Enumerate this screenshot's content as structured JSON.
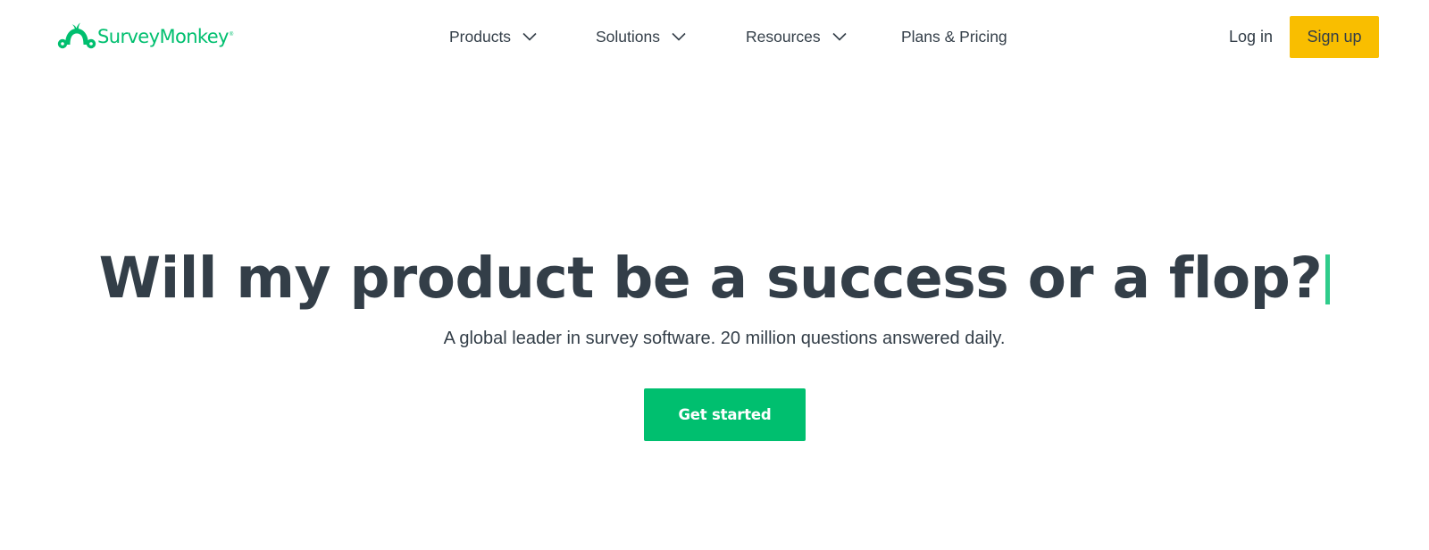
{
  "header": {
    "logo": {
      "text": "SurveyMonkey",
      "registered": "®",
      "icon": "surveymonkey-logo-icon",
      "color": "#00bf6f"
    },
    "nav": [
      {
        "label": "Products",
        "has_dropdown": true,
        "icon": "chevron-down-icon"
      },
      {
        "label": "Solutions",
        "has_dropdown": true,
        "icon": "chevron-down-icon"
      },
      {
        "label": "Resources",
        "has_dropdown": true,
        "icon": "chevron-down-icon"
      },
      {
        "label": "Plans & Pricing",
        "has_dropdown": false
      }
    ],
    "login_label": "Log in",
    "signup_label": "Sign up",
    "signup_color": "#f9be00"
  },
  "hero": {
    "title": "Will my product be a success or a flop?",
    "caret_color": "#2fcc8b",
    "subtitle": "A global leader in survey software. 20 million questions answered daily.",
    "cta_label": "Get started",
    "cta_color": "#00bf6f",
    "text_color": "#333e48"
  }
}
